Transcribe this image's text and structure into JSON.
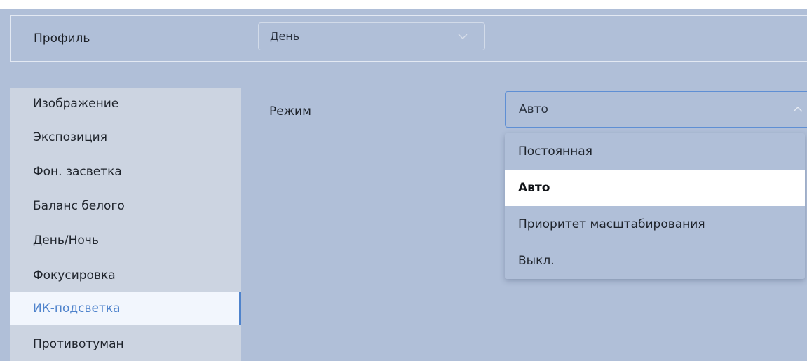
{
  "profile": {
    "label": "Профиль",
    "selected": "День"
  },
  "sidebar": {
    "items": [
      {
        "label": "Изображение"
      },
      {
        "label": "Экспозиция"
      },
      {
        "label": "Фон. засветка"
      },
      {
        "label": "Баланс белого"
      },
      {
        "label": "День/Ночь"
      },
      {
        "label": "Фокусировка"
      },
      {
        "label": "ИК-подсветка",
        "active": true
      },
      {
        "label": "Противотуман"
      }
    ]
  },
  "mode": {
    "label": "Режим",
    "selected": "Авто",
    "options": [
      {
        "label": "Постоянная"
      },
      {
        "label": "Авто",
        "selected": true
      },
      {
        "label": "Приоритет масштабирования"
      },
      {
        "label": "Выкл."
      }
    ]
  },
  "icons": {
    "profile_chevron": "chevron-down-icon",
    "mode_chevron": "chevron-up-icon"
  },
  "colors": {
    "background": "#b0bfd8",
    "sidebar": "#ccd4e1",
    "accent": "#4f83cc",
    "active_item_bg": "#f2f6fd"
  }
}
